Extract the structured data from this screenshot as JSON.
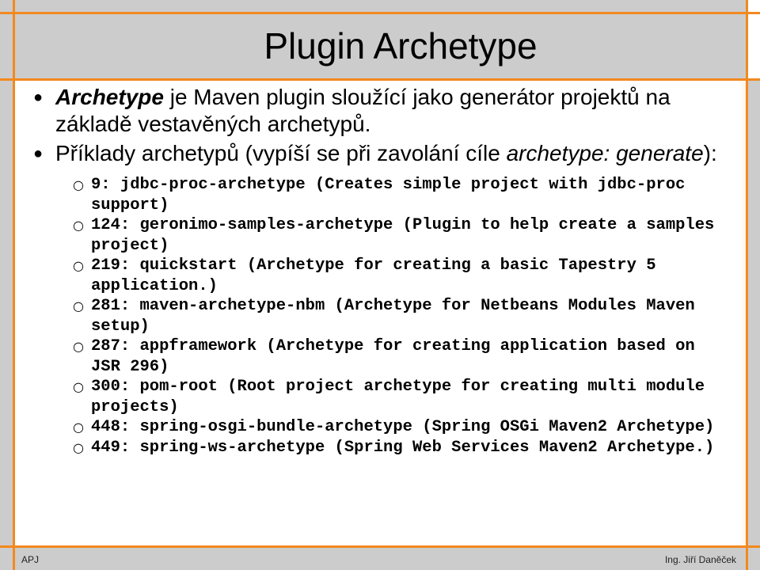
{
  "slide": {
    "title": "Plugin Archetype",
    "bullets": [
      {
        "segments": [
          {
            "text": "Archetype",
            "style": "bold-italic"
          },
          {
            "text": " je Maven plugin sloužící jako generátor projektů na základě vestavěných archetypů.",
            "style": "normal"
          }
        ]
      },
      {
        "segments": [
          {
            "text": "Příklady archetypů (vypíší se při zavolání cíle ",
            "style": "normal"
          },
          {
            "text": "archetype: generate",
            "style": "italic"
          },
          {
            "text": "):",
            "style": "normal"
          }
        ],
        "sub_items": [
          "9: jdbc-proc-archetype (Creates simple project with jdbc-proc support)",
          "124: geronimo-samples-archetype (Plugin to help create a samples project)",
          "219: quickstart (Archetype for creating a basic Tapestry 5 application.)",
          "281: maven-archetype-nbm (Archetype for Netbeans Modules Maven setup)",
          "287: appframework (Archetype for creating application based on JSR 296)",
          "300: pom-root (Root project archetype for creating multi module projects)",
          "448: spring-osgi-bundle-archetype (Spring OSGi Maven2 Archetype)",
          "449: spring-ws-archetype (Spring Web Services Maven2 Archetype.)"
        ]
      }
    ],
    "bullet_icons": {
      "level1": "●",
      "level2": "○"
    }
  },
  "footer": {
    "left": "APJ",
    "right": "Ing. Jiří Daněček"
  },
  "colors": {
    "accent": "#f2891f",
    "band": "#cccccc",
    "content_bg": "#ffffff"
  }
}
